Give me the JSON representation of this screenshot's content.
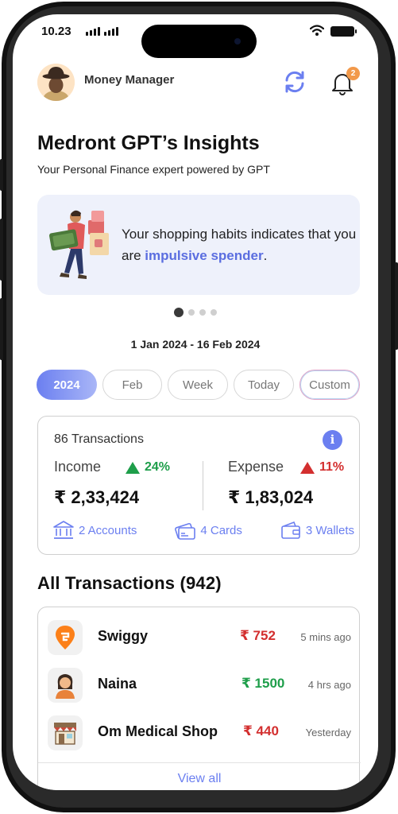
{
  "status_bar": {
    "time": "10.23"
  },
  "header": {
    "app_title": "Money Manager",
    "notification_count": "2"
  },
  "insights": {
    "title": "Medront GPT’s Insights",
    "subtitle": "Your Personal Finance expert powered by GPT",
    "card_text_prefix": "Your shopping habits indicates that you are ",
    "card_text_highlight": "impulsive spender",
    "card_text_suffix": "."
  },
  "date_range": "1 Jan 2024 - 16 Feb 2024",
  "filters": [
    {
      "label": "2024",
      "active": true
    },
    {
      "label": "Feb",
      "active": false
    },
    {
      "label": "Week",
      "active": false
    },
    {
      "label": "Today",
      "active": false
    },
    {
      "label": "Custom",
      "active": false
    }
  ],
  "summary": {
    "transactions_label": "86 Transactions",
    "income_label": "Income",
    "income_change": "24%",
    "income_amount": "₹ 2,33,424",
    "expense_label": "Expense",
    "expense_change": "11%",
    "expense_amount": "₹ 1,83,024",
    "accounts_label": "2 Accounts",
    "cards_label": "4 Cards",
    "wallets_label": "3 Wallets"
  },
  "all_transactions": {
    "title": "All Transactions (942)",
    "items": [
      {
        "name": "Swiggy",
        "amount": "₹ 752",
        "type": "debit",
        "time": "5 mins ago"
      },
      {
        "name": "Naina",
        "amount": "₹ 1500",
        "type": "credit",
        "time": "4 hrs ago"
      },
      {
        "name": "Om Medical Shop",
        "amount": "₹ 440",
        "type": "debit",
        "time": "Yesterday"
      }
    ],
    "view_all_label": "View all"
  },
  "colors": {
    "accent": "#6b7ff0",
    "positive": "#1e9e4a",
    "negative": "#d32f2f",
    "badge": "#f2994a"
  }
}
